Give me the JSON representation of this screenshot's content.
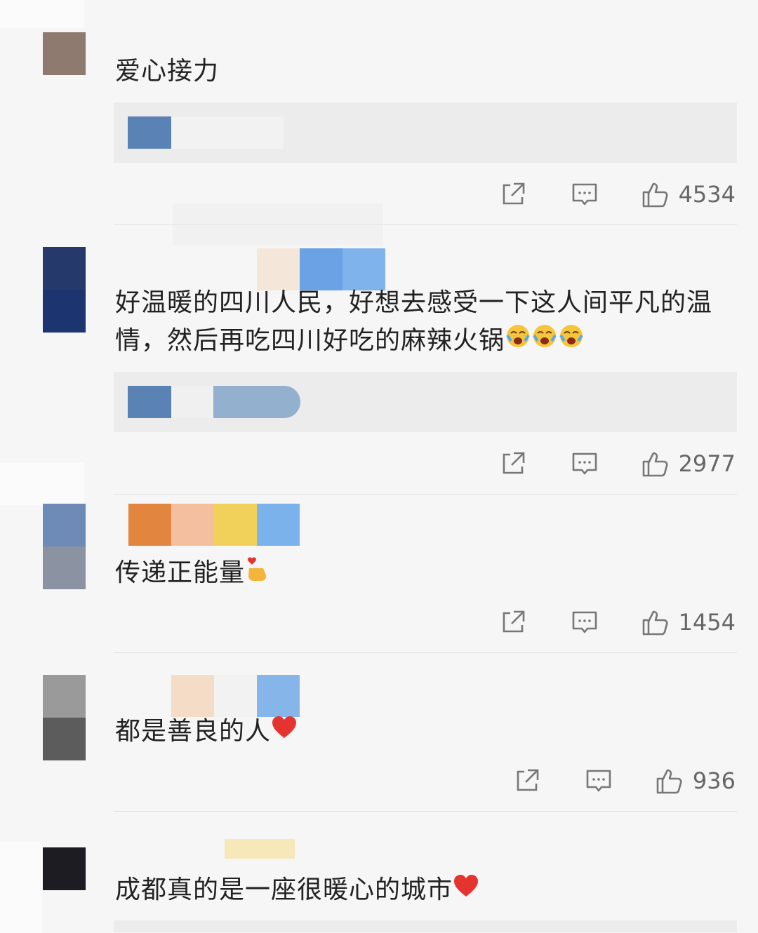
{
  "comments": [
    {
      "text": "爱心接力",
      "likes": "4534"
    },
    {
      "text": "好温暖的四川人民，好想去感受一下这人间平凡的温情，然后再吃四川好吃的麻辣火锅",
      "likes": "2977",
      "emoji": [
        "crying-laughing-face-emoji",
        "crying-laughing-face-emoji",
        "crying-laughing-face-emoji"
      ]
    },
    {
      "text": "传递正能量",
      "likes": "1454",
      "emoji": [
        "heart-hands-emoji"
      ]
    },
    {
      "text": "都是善良的人",
      "likes": "936",
      "emoji": [
        "red-heart-emoji"
      ]
    },
    {
      "text": "成都真的是一座很暖心的城市",
      "emoji": [
        "red-heart-emoji"
      ]
    }
  ],
  "icons": {
    "share": "share-icon",
    "comment": "comment-icon",
    "like": "thumbs-up-icon"
  },
  "colors": {
    "text": "#222222",
    "count": "#666666",
    "heart": "#e5342f"
  }
}
